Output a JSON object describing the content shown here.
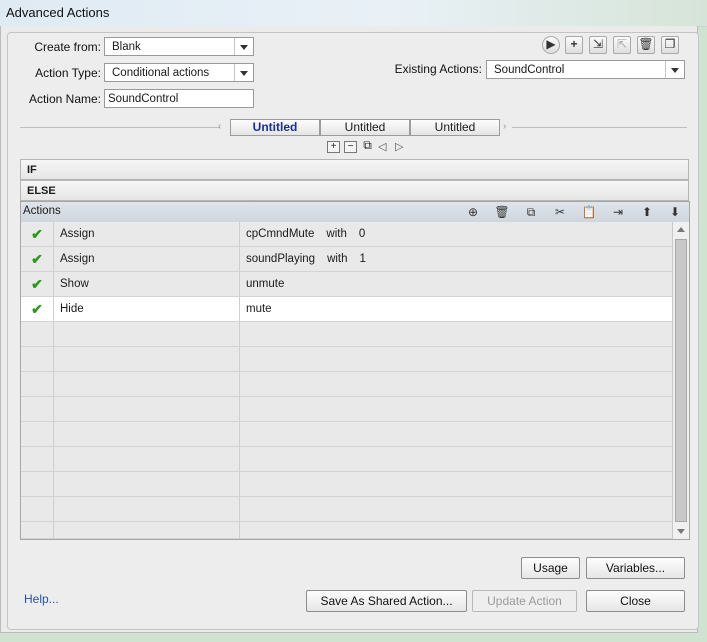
{
  "window": {
    "title": "Advanced Actions"
  },
  "form": {
    "create_from_label": "Create from:",
    "create_from_value": "Blank",
    "action_type_label": "Action Type:",
    "action_type_value": "Conditional actions",
    "action_name_label": "Action Name:",
    "action_name_value": "SoundControl",
    "existing_actions_label": "Existing Actions:",
    "existing_actions_value": "SoundControl"
  },
  "toolbar_icons": [
    "preview-icon",
    "add-action-icon",
    "import-icon",
    "export-icon",
    "delete-icon",
    "duplicate-icon"
  ],
  "tabs": [
    {
      "label": "Untitled",
      "active": true
    },
    {
      "label": "Untitled",
      "active": false
    },
    {
      "label": "Untitled",
      "active": false
    }
  ],
  "sections": {
    "if_label": "IF",
    "else_label": "ELSE"
  },
  "actions_grid": {
    "header": "Actions",
    "rows": [
      {
        "status": "✔",
        "command": "Assign",
        "target": "cpCmndMute",
        "op": "with",
        "value": "0"
      },
      {
        "status": "✔",
        "command": "Assign",
        "target": "soundPlaying",
        "op": "with",
        "value": "1"
      },
      {
        "status": "✔",
        "command": "Show",
        "target": "unmute",
        "op": "",
        "value": ""
      },
      {
        "status": "✔",
        "command": "Hide",
        "target": "mute",
        "op": "",
        "value": ""
      }
    ]
  },
  "buttons": {
    "usage": "Usage",
    "variables": "Variables...",
    "help": "Help...",
    "save_shared": "Save As Shared Action...",
    "update": "Update Action",
    "close": "Close"
  }
}
